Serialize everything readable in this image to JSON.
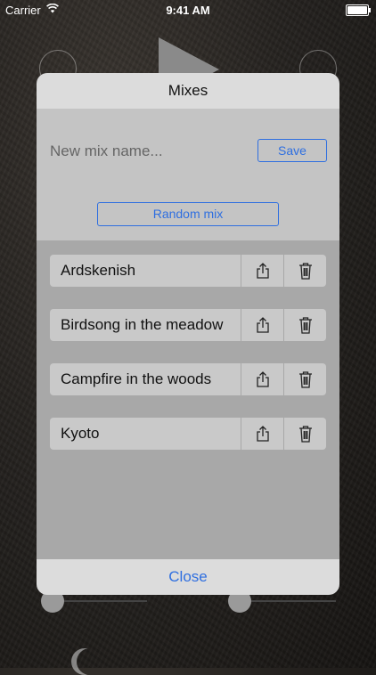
{
  "status_bar": {
    "carrier": "Carrier",
    "time": "9:41 AM"
  },
  "dialog": {
    "title": "Mixes",
    "name_input": {
      "placeholder": "New mix name...",
      "value": ""
    },
    "save_label": "Save",
    "random_label": "Random mix",
    "mixes": [
      {
        "name": "Ardskenish"
      },
      {
        "name": "Birdsong in the meadow"
      },
      {
        "name": "Campfire in the woods"
      },
      {
        "name": "Kyoto"
      }
    ],
    "close_label": "Close"
  },
  "colors": {
    "accent": "#2f6fe0"
  },
  "icons": {
    "share": "share-icon",
    "trash": "trash-icon",
    "wifi": "wifi-icon",
    "battery": "battery-icon"
  }
}
